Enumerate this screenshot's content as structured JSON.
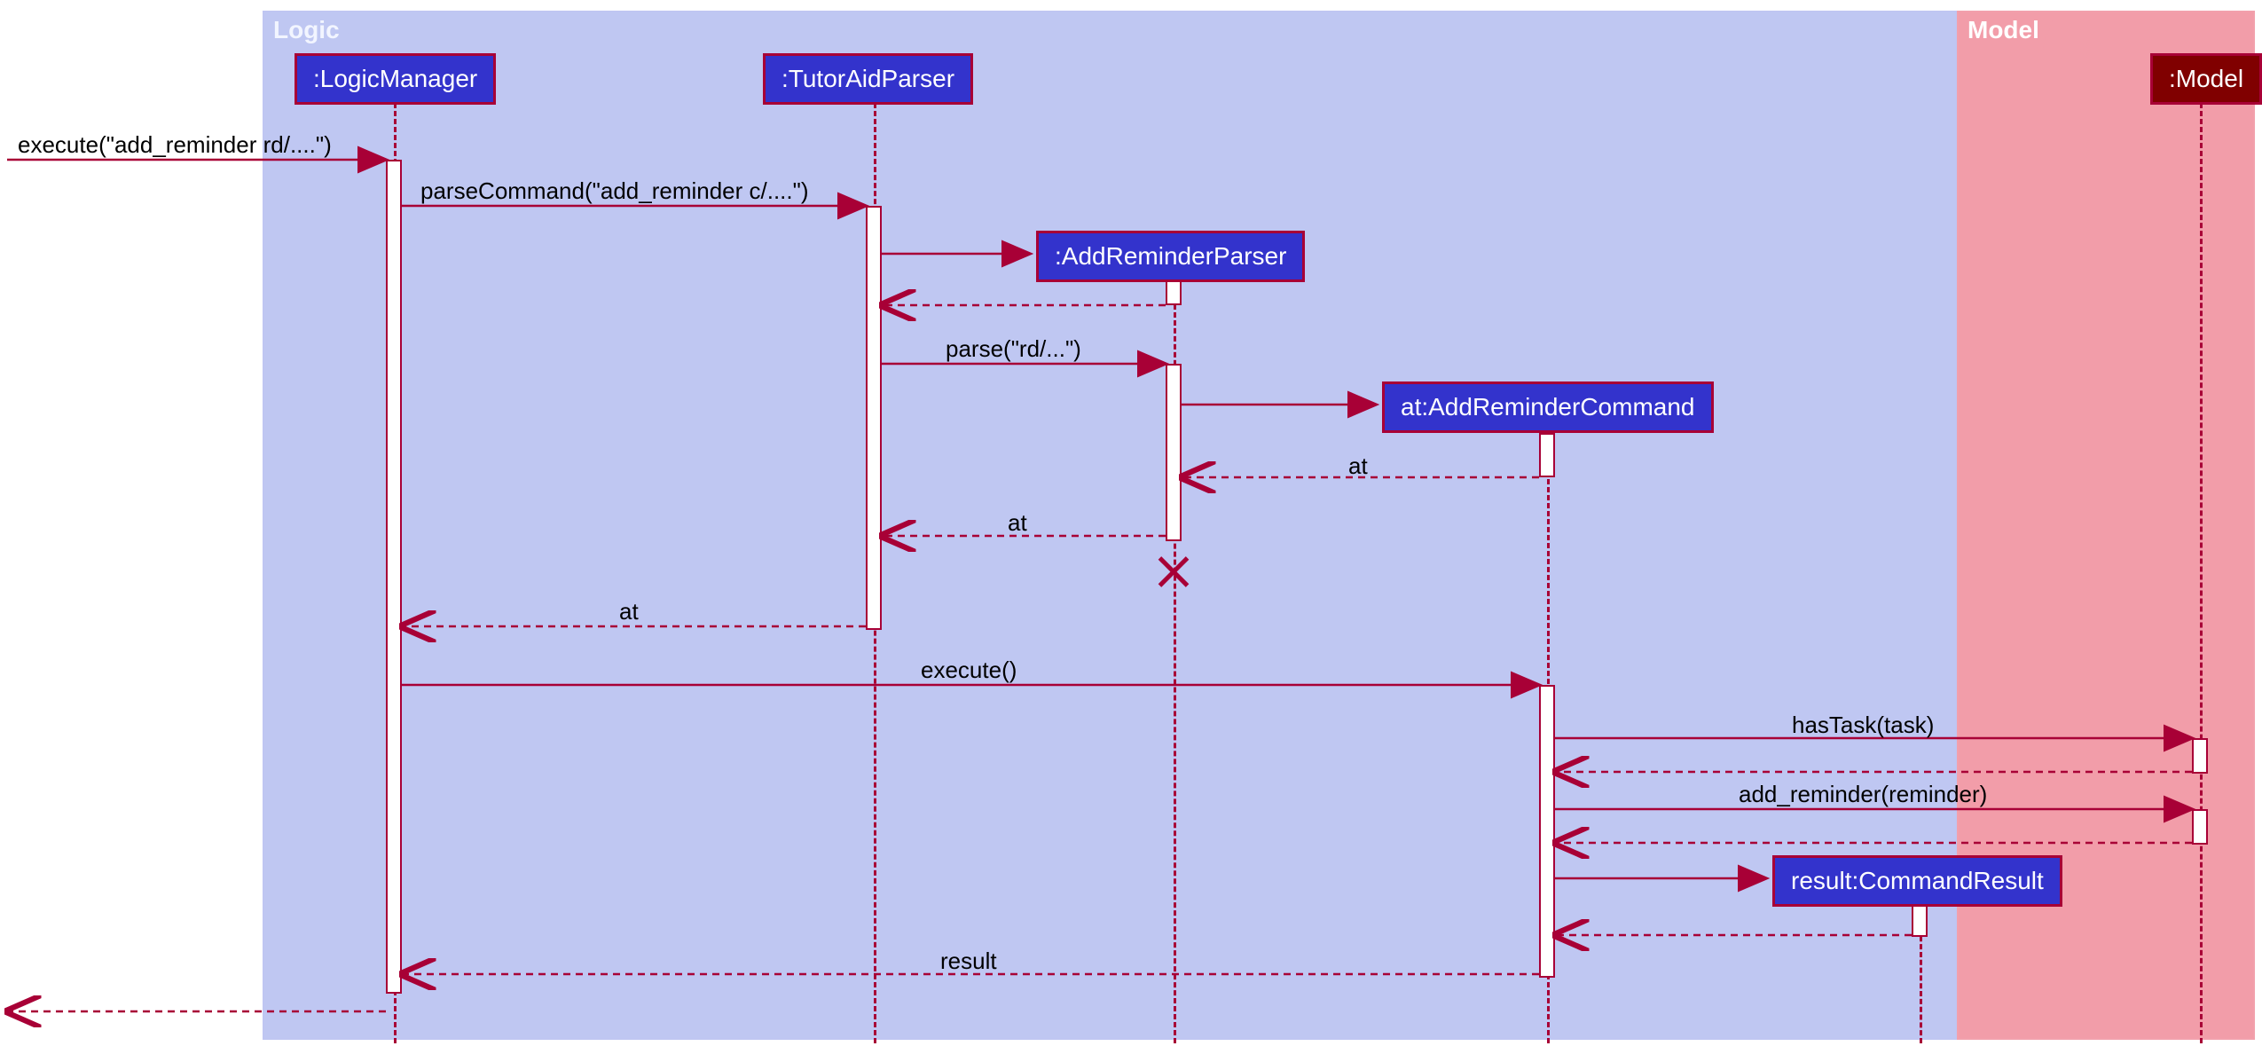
{
  "diagram_type": "UML Sequence Diagram",
  "frames": {
    "logic": {
      "label": "Logic"
    },
    "model": {
      "label": "Model"
    }
  },
  "participants": {
    "logicManager": ":LogicManager",
    "tutorAidParser": ":TutorAidParser",
    "addReminderParser": ":AddReminderParser",
    "addReminderCommand": "at:AddReminderCommand",
    "commandResult": "result:CommandResult",
    "model": ":Model"
  },
  "messages": {
    "m1": "execute(\"add_reminder rd/....\")",
    "m2": "parseCommand(\"add_reminder c/....\")",
    "m3": "parse(\"rd/...\")",
    "r_at1": "at",
    "r_at2": "at",
    "r_at3": "at",
    "m_exec": "execute()",
    "m_hasTask": "hasTask(task)",
    "m_addRem": "add_reminder(reminder)",
    "r_result": "result"
  },
  "chart_data": {
    "type": "sequence_diagram",
    "participants": [
      {
        "id": "Caller",
        "name": "(external)",
        "frame": null
      },
      {
        "id": "LogicManager",
        "name": ":LogicManager",
        "frame": "Logic"
      },
      {
        "id": "TutorAidParser",
        "name": ":TutorAidParser",
        "frame": "Logic"
      },
      {
        "id": "AddReminderParser",
        "name": ":AddReminderParser",
        "frame": "Logic",
        "created": true,
        "destroyed": true
      },
      {
        "id": "AddReminderCommand",
        "name": "at:AddReminderCommand",
        "frame": "Logic",
        "created": true
      },
      {
        "id": "CommandResult",
        "name": "result:CommandResult",
        "frame": "Logic",
        "created": true
      },
      {
        "id": "Model",
        "name": ":Model",
        "frame": "Model"
      }
    ],
    "interactions": [
      {
        "from": "Caller",
        "to": "LogicManager",
        "label": "execute(\"add_reminder rd/....\")",
        "type": "sync"
      },
      {
        "from": "LogicManager",
        "to": "TutorAidParser",
        "label": "parseCommand(\"add_reminder c/....\")",
        "type": "sync"
      },
      {
        "from": "TutorAidParser",
        "to": "AddReminderParser",
        "label": "",
        "type": "create"
      },
      {
        "from": "AddReminderParser",
        "to": "TutorAidParser",
        "label": "",
        "type": "return"
      },
      {
        "from": "TutorAidParser",
        "to": "AddReminderParser",
        "label": "parse(\"rd/...\")",
        "type": "sync"
      },
      {
        "from": "AddReminderParser",
        "to": "AddReminderCommand",
        "label": "",
        "type": "create"
      },
      {
        "from": "AddReminderCommand",
        "to": "AddReminderParser",
        "label": "at",
        "type": "return"
      },
      {
        "from": "AddReminderParser",
        "to": "TutorAidParser",
        "label": "at",
        "type": "return"
      },
      {
        "from": "AddReminderParser",
        "to": null,
        "label": "",
        "type": "destroy"
      },
      {
        "from": "TutorAidParser",
        "to": "LogicManager",
        "label": "at",
        "type": "return"
      },
      {
        "from": "LogicManager",
        "to": "AddReminderCommand",
        "label": "execute()",
        "type": "sync"
      },
      {
        "from": "AddReminderCommand",
        "to": "Model",
        "label": "hasTask(task)",
        "type": "sync"
      },
      {
        "from": "Model",
        "to": "AddReminderCommand",
        "label": "",
        "type": "return"
      },
      {
        "from": "AddReminderCommand",
        "to": "Model",
        "label": "add_reminder(reminder)",
        "type": "sync"
      },
      {
        "from": "Model",
        "to": "AddReminderCommand",
        "label": "",
        "type": "return"
      },
      {
        "from": "AddReminderCommand",
        "to": "CommandResult",
        "label": "",
        "type": "create"
      },
      {
        "from": "CommandResult",
        "to": "AddReminderCommand",
        "label": "",
        "type": "return"
      },
      {
        "from": "AddReminderCommand",
        "to": "LogicManager",
        "label": "result",
        "type": "return"
      },
      {
        "from": "LogicManager",
        "to": "Caller",
        "label": "",
        "type": "return"
      }
    ]
  }
}
